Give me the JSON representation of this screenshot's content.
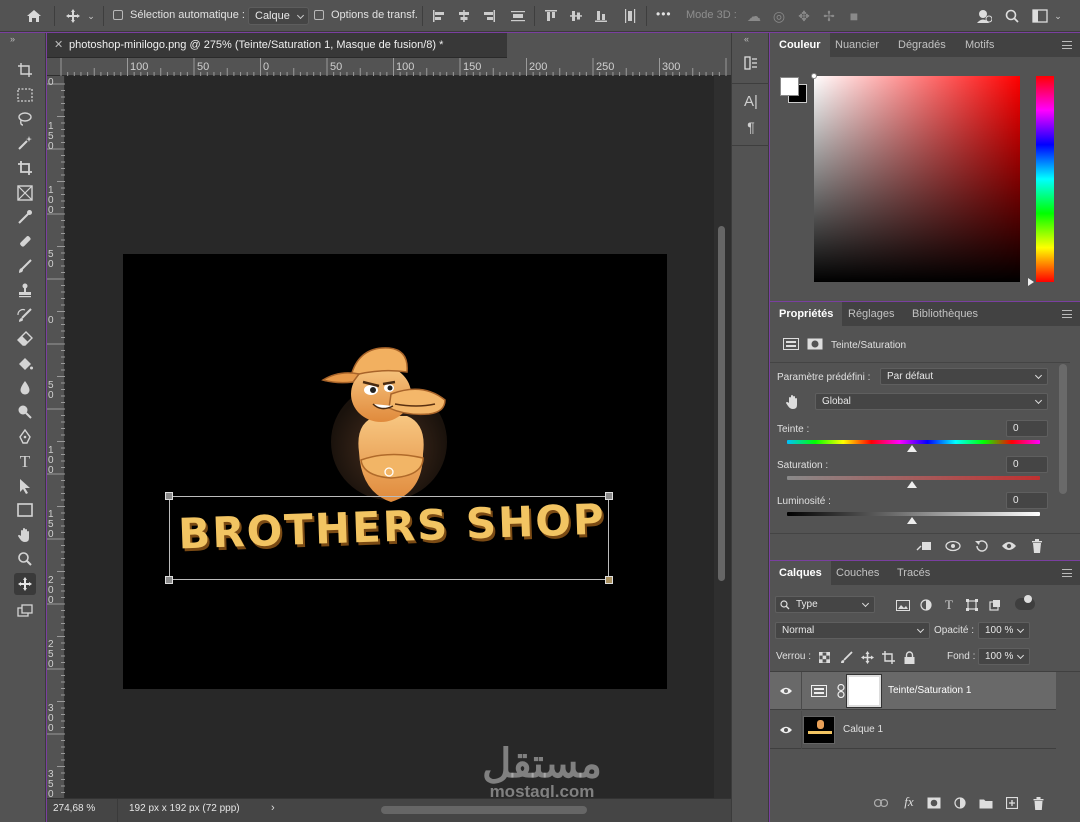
{
  "toolbar_options": {
    "auto_select_label": "Sélection automatique :",
    "auto_select_value": "Calque",
    "transform_label": "Options de transf.",
    "mode3d_label": "Mode 3D :",
    "more": "•••"
  },
  "document": {
    "tab_title": "photoshop-minilogo.png @ 275% (Teinte/Saturation 1, Masque de fusion/8) *",
    "canvas_text": "BROTHERS SHOP",
    "zoom": "274,68 %",
    "info": "192 px x 192 px (72 ppp)",
    "ruler_h": [
      "100",
      "50",
      "0",
      "50",
      "100",
      "150",
      "200",
      "250",
      "300"
    ],
    "ruler_v": [
      "0",
      "1\n5\n0",
      "1\n0\n0",
      "5\n0",
      "0",
      "5\n0",
      "1\n0\n0",
      "1\n5\n0",
      "2\n0\n0",
      "2\n5\n0",
      "3\n0\n0",
      "3\n5\n0"
    ]
  },
  "color_panel": {
    "tabs": [
      "Couleur",
      "Nuancier",
      "Dégradés",
      "Motifs"
    ]
  },
  "properties_panel": {
    "tabs": [
      "Propriétés",
      "Réglages",
      "Bibliothèques"
    ],
    "adjustment_name": "Teinte/Saturation",
    "preset_label": "Paramètre prédéfini :",
    "preset_value": "Par défaut",
    "channel_value": "Global",
    "hue_label": "Teinte :",
    "hue_value": "0",
    "saturation_label": "Saturation :",
    "saturation_value": "0",
    "lightness_label": "Luminosité :",
    "lightness_value": "0"
  },
  "layers_panel": {
    "tabs": [
      "Calques",
      "Couches",
      "Tracés"
    ],
    "filter_value": "Type",
    "blend_mode": "Normal",
    "opacity_label": "Opacité :",
    "opacity_value": "100 %",
    "lock_label": "Verrou :",
    "fill_label": "Fond :",
    "fill_value": "100 %",
    "layers": [
      {
        "name": "Teinte/Saturation 1"
      },
      {
        "name": "Calque 1"
      }
    ]
  },
  "watermark": {
    "arabic": "مستقل",
    "latin": "mostaql.com"
  },
  "colors": {
    "accent_gold": "#f2c462",
    "panel_bg": "#535353",
    "canvas_bg": "#000000"
  }
}
